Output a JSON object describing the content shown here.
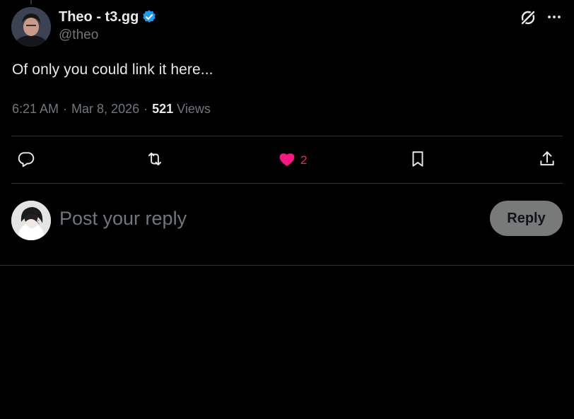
{
  "tweet": {
    "author": {
      "display_name": "Theo - t3.gg",
      "handle": "@theo",
      "verified": true
    },
    "text": "Of only you could link it here...",
    "time": "6:21 AM",
    "separator": "·",
    "date": "Mar 8, 2026",
    "views_count": "521",
    "views_label": "Views"
  },
  "actions": {
    "like_count": "2"
  },
  "icons": {
    "verified": "verified-badge-icon",
    "grok": "grok-icon",
    "more": "more-icon",
    "reply": "reply-icon",
    "retweet": "retweet-icon",
    "like": "heart-filled-icon",
    "bookmark": "bookmark-icon",
    "share": "share-icon"
  },
  "reply_box": {
    "placeholder": "Post your reply",
    "button_label": "Reply"
  },
  "colors": {
    "background": "#000000",
    "text": "#e7e9ea",
    "secondary_text": "#71767b",
    "divider": "#2f3336",
    "verified": "#1d9bf0",
    "like": "#f91880",
    "reply_button_bg": "#787a7a"
  }
}
